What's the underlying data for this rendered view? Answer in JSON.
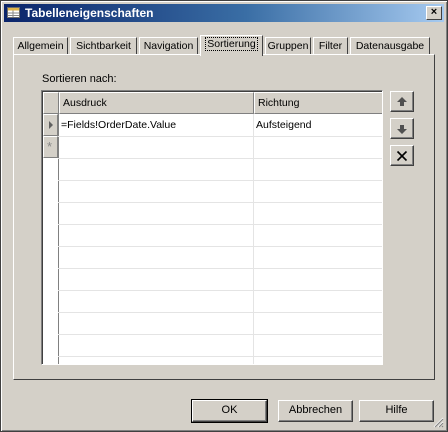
{
  "window": {
    "title": "Tabelleneigenschaften",
    "close_glyph": "×"
  },
  "tabs": [
    {
      "label": "Allgemein",
      "active": false
    },
    {
      "label": "Sichtbarkeit",
      "active": false
    },
    {
      "label": "Navigation",
      "active": false
    },
    {
      "label": "Sortierung",
      "active": true
    },
    {
      "label": "Gruppen",
      "active": false
    },
    {
      "label": "Filter",
      "active": false
    },
    {
      "label": "Datenausgabe",
      "active": false
    }
  ],
  "sorting": {
    "label": "Sortieren nach:",
    "columns": [
      "Ausdruck",
      "Richtung"
    ],
    "rows": [
      {
        "expression": "=Fields!OrderDate.Value",
        "direction": "Aufsteigend"
      }
    ],
    "new_row_marker": "*",
    "side_buttons": [
      "arrow-up-icon",
      "arrow-down-icon",
      "delete-x-icon"
    ]
  },
  "buttons": {
    "ok": "OK",
    "cancel": "Abbrechen",
    "help": "Hilfe"
  },
  "colors": {
    "title_start": "#0a246a",
    "title_end": "#a6caf0",
    "face": "#d4d0c8"
  }
}
